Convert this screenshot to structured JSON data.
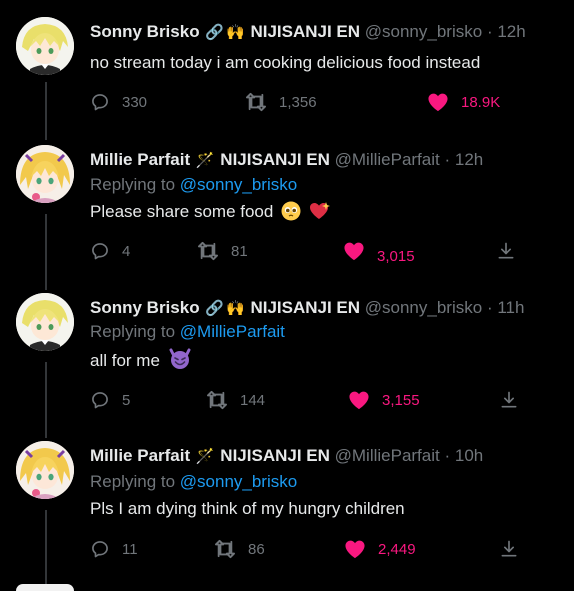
{
  "tweets": [
    {
      "name": "Sonny Brisko",
      "badges": [
        "link-emoji",
        "raised-hands-emoji"
      ],
      "org": "NIJISANJI EN",
      "handle": "@sonny_brisko",
      "time": "12h",
      "reply_prefix": "",
      "reply_to": "",
      "text": "no stream today i am cooking delicious food instead",
      "text_emoji": [],
      "replies": "330",
      "retweets": "1,356",
      "likes": "18.9K",
      "share": false,
      "avatar": "sonny-avatar"
    },
    {
      "name": "Millie Parfait",
      "badges": [
        "magic-wand-emoji"
      ],
      "org": "NIJISANJI EN",
      "handle": "@MillieParfait",
      "time": "12h",
      "reply_prefix": "Replying to ",
      "reply_to": "@sonny_brisko",
      "text": "Please share some food",
      "text_emoji": [
        "pleading-face-emoji",
        "sparkling-heart-emoji"
      ],
      "replies": "4",
      "retweets": "81",
      "likes": "3,015",
      "share": true,
      "avatar": "millie-avatar"
    },
    {
      "name": "Sonny Brisko",
      "badges": [
        "link-emoji",
        "raised-hands-emoji"
      ],
      "org": "NIJISANJI EN",
      "handle": "@sonny_brisko",
      "time": "11h",
      "reply_prefix": "Replying to ",
      "reply_to": "@MillieParfait",
      "text": "all for me",
      "text_emoji": [
        "smiling-devil-emoji"
      ],
      "replies": "5",
      "retweets": "144",
      "likes": "3,155",
      "share": true,
      "avatar": "sonny-avatar"
    },
    {
      "name": "Millie Parfait",
      "badges": [
        "magic-wand-emoji"
      ],
      "org": "NIJISANJI EN",
      "handle": "@MillieParfait",
      "time": "10h",
      "reply_prefix": "Replying to ",
      "reply_to": "@sonny_brisko",
      "text": "Pls I am dying think of my hungry children",
      "text_emoji": [],
      "replies": "11",
      "retweets": "86",
      "likes": "2,449",
      "share": true,
      "avatar": "millie-avatar"
    }
  ],
  "separator": "·",
  "colors": {
    "background": "#000000",
    "text": "#e7e9ea",
    "muted": "#71767b",
    "link": "#1d9bf0",
    "like": "#f91880",
    "thread_line": "#333639"
  }
}
